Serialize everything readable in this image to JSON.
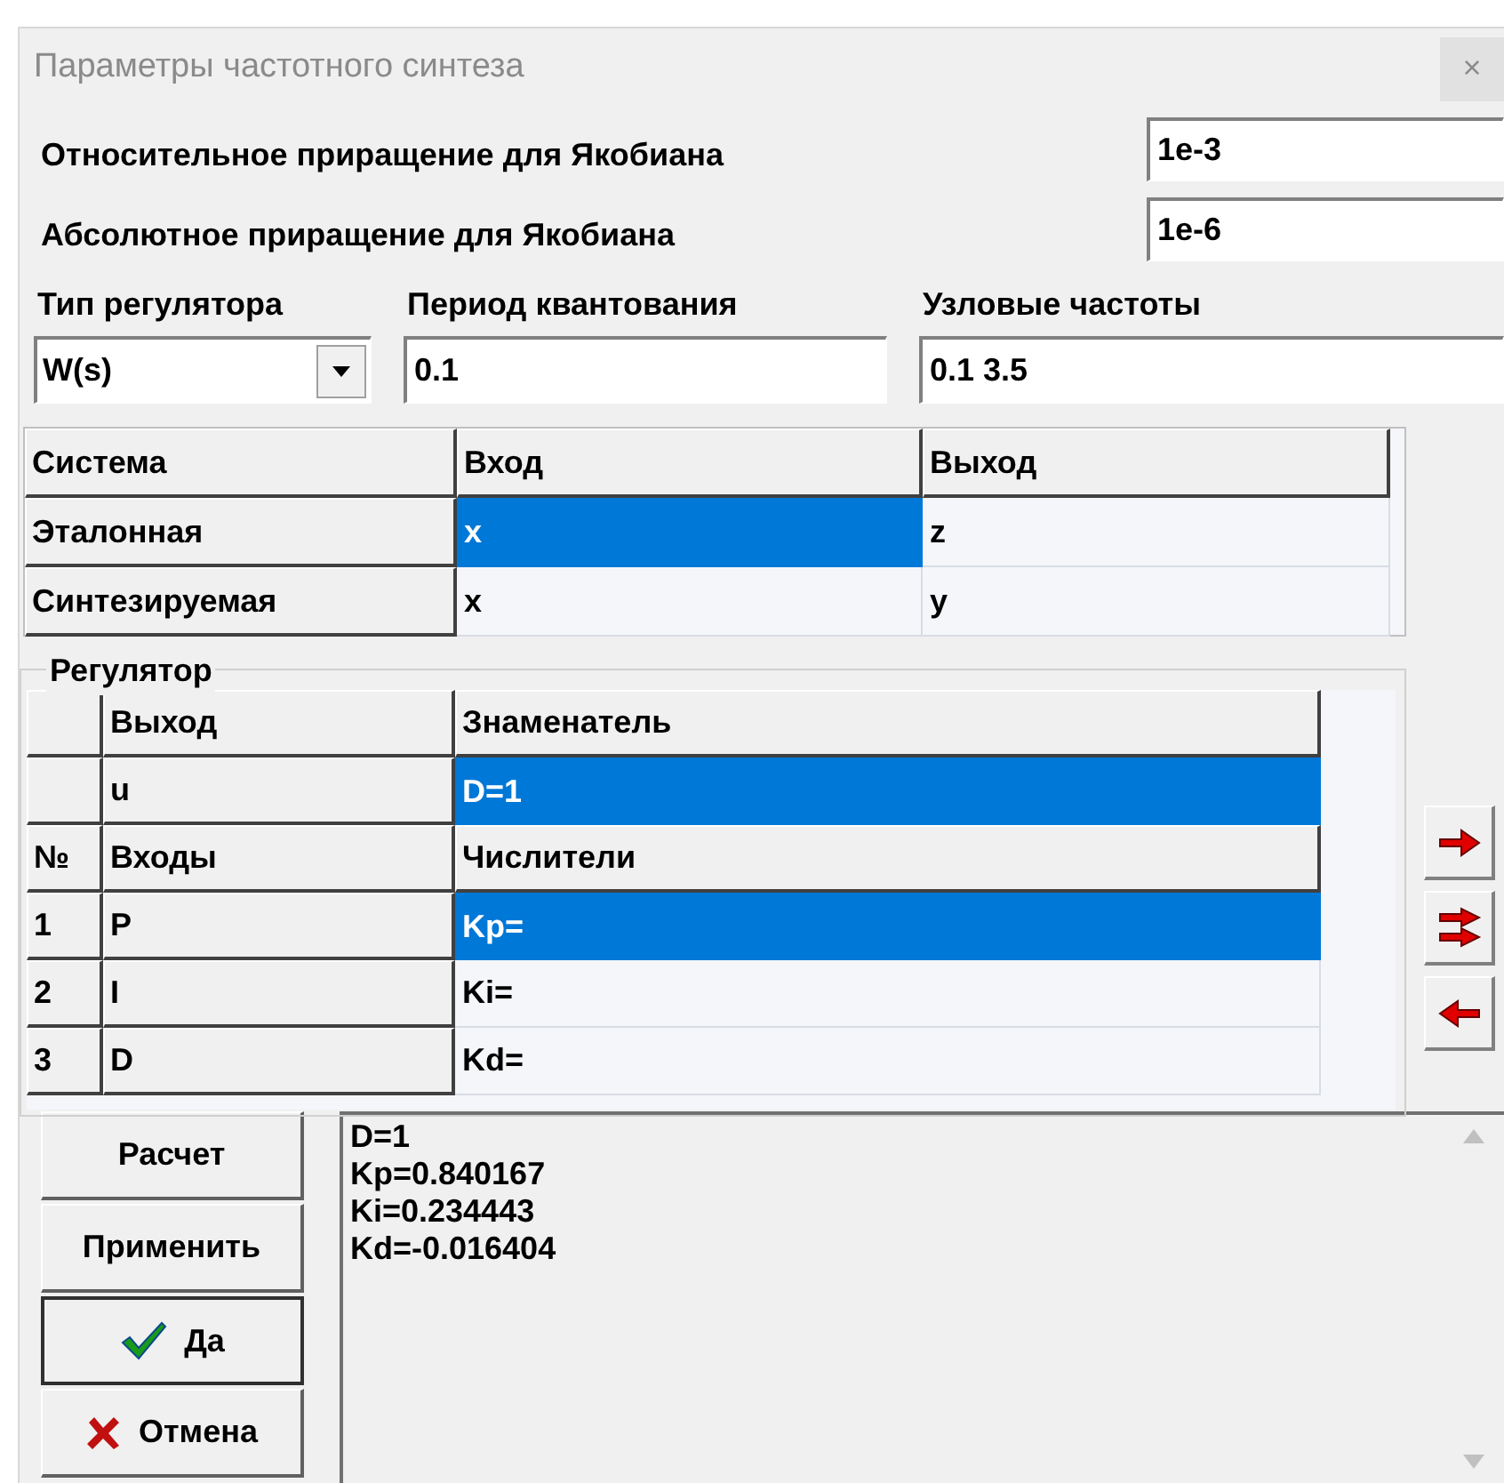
{
  "window": {
    "title": "Параметры частотного синтеза",
    "close": "×"
  },
  "jacobian": [
    {
      "label": "Относительное приращение для Якобиана",
      "value": "1e-3"
    },
    {
      "label": "Абсолютное приращение для Якобиана",
      "value": "1e-6"
    }
  ],
  "settings": {
    "regulator_type": {
      "label": "Тип регулятора",
      "value": "W(s)"
    },
    "sampling_period": {
      "label": "Период квантования",
      "value": "0.1"
    },
    "node_frequencies": {
      "label": "Узловые частоты",
      "value": "0.1 3.5"
    }
  },
  "system_table": {
    "columns": [
      "Система",
      "Вход",
      "Выход"
    ],
    "rows": [
      {
        "name": "Эталонная",
        "input": {
          "text": "x",
          "selected": true
        },
        "output": {
          "text": "z",
          "selected": false
        }
      },
      {
        "name": "Синтезируемая",
        "input": {
          "text": "x",
          "selected": false
        },
        "output": {
          "text": "y",
          "selected": false
        }
      }
    ]
  },
  "regulator": {
    "title": "Регулятор",
    "rows": [
      {
        "kind": "header",
        "cells": [
          "Выход",
          "Знаменатель"
        ]
      },
      {
        "kind": "data",
        "name": "u",
        "value": {
          "text": "D=1",
          "selected": true
        }
      },
      {
        "kind": "header",
        "number": "№",
        "cells": [
          "Входы",
          "Числители"
        ]
      },
      {
        "kind": "data",
        "number": "1",
        "name": "P",
        "value": {
          "text": "Kp=",
          "selected": true
        }
      },
      {
        "kind": "data",
        "number": "2",
        "name": "I",
        "value": {
          "text": "Ki=",
          "selected": false
        }
      },
      {
        "kind": "data",
        "number": "3",
        "name": "D",
        "value": {
          "text": "Kd=",
          "selected": false
        }
      }
    ]
  },
  "arrow_buttons": [
    {
      "kind": "right"
    },
    {
      "kind": "double_right"
    },
    {
      "kind": "left"
    }
  ],
  "buttons": [
    {
      "label": "Расчет",
      "default": false
    },
    {
      "label": "Применить",
      "default": false
    },
    {
      "label": "Да",
      "kind": "check",
      "default": true
    },
    {
      "label": "Отмена",
      "kind": "cross",
      "default": false
    }
  ],
  "output": {
    "lines": [
      "D=1",
      "Kp=0.840167",
      "Ki=0.234443",
      "Kd=-0.016404"
    ]
  }
}
